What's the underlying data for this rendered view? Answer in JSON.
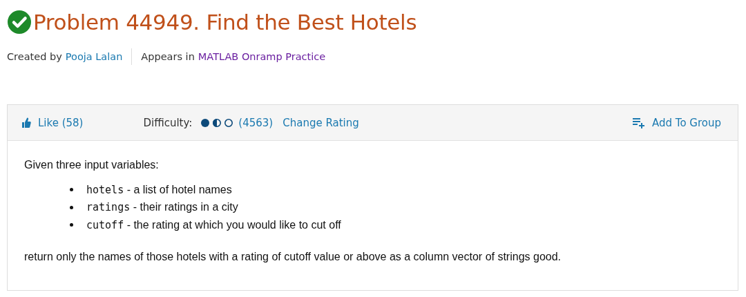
{
  "problem": {
    "solved": true,
    "title": "Problem 44949. Find the Best Hotels"
  },
  "byline": {
    "created_label": "Created by",
    "author": "Pooja Lalan",
    "appears_label": "Appears in",
    "group": "MATLAB Onramp Practice"
  },
  "toolbar": {
    "like": "Like (58)",
    "difficulty_label": "Difficulty:",
    "difficulty": [
      {
        "kind": "full"
      },
      {
        "kind": "half"
      },
      {
        "kind": "empty"
      }
    ],
    "rating_count": "(4563)",
    "change_rating": "Change Rating",
    "add_to_group": "Add To Group"
  },
  "description": {
    "intro": "Given three input variables:",
    "items": [
      {
        "term": "hotels",
        "text": "- a list of hotel names"
      },
      {
        "term": "ratings",
        "text": "- their ratings in a city"
      },
      {
        "term": "cutoff",
        "text": "- the rating at which you would like to cut off"
      }
    ],
    "outro": "return only the names of those hotels with a rating of cutoff value or above as a column vector of strings good."
  }
}
